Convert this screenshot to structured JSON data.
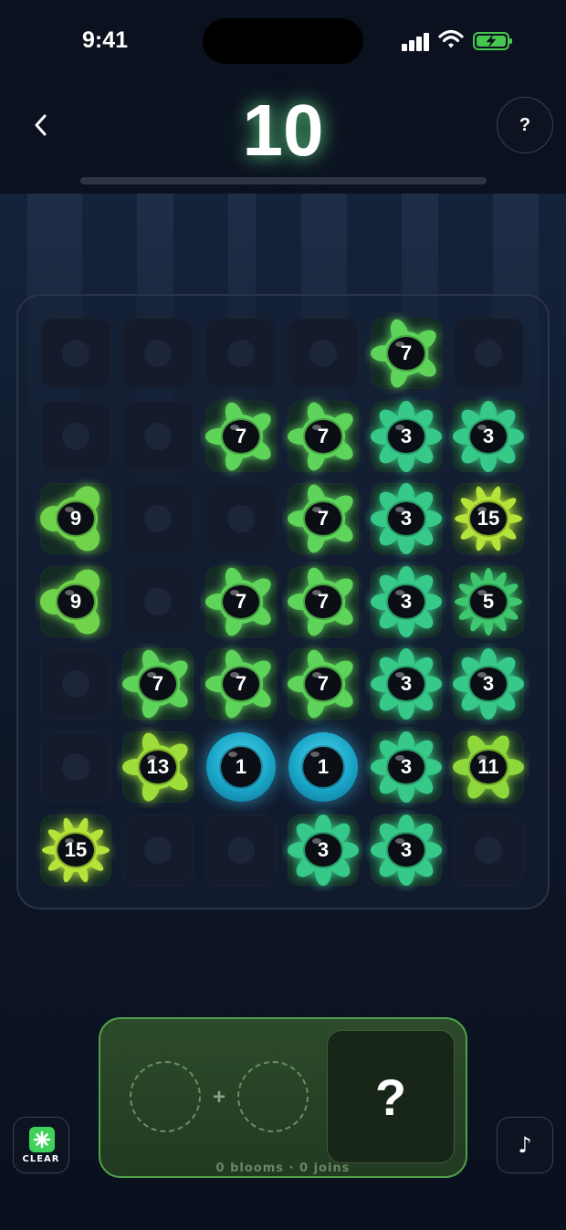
{
  "status_bar": {
    "time": "9:41"
  },
  "header": {
    "target": "10",
    "help_label": "?"
  },
  "board": {
    "rows": 7,
    "cols": 6,
    "cells": [
      [
        null,
        null,
        null,
        null,
        7,
        null
      ],
      [
        null,
        null,
        7,
        7,
        3,
        3
      ],
      [
        9,
        null,
        null,
        7,
        3,
        15
      ],
      [
        9,
        null,
        7,
        7,
        3,
        5
      ],
      [
        null,
        7,
        7,
        7,
        3,
        3
      ],
      [
        null,
        13,
        1,
        1,
        3,
        11
      ],
      [
        15,
        null,
        null,
        3,
        3,
        null
      ]
    ]
  },
  "tray": {
    "plus": "+",
    "result": "?",
    "stats": "0 blooms · 0 joins"
  },
  "controls": {
    "clear_label": "CLEAR",
    "music_icon": "♪"
  },
  "colors": {
    "3": "#36c98a",
    "5": "#3ec76e",
    "7": "#5ed45a",
    "9": "#6fd44c",
    "11": "#8ed83c",
    "13": "#9ede3a",
    "15": "#b4e33a",
    "1": "#22b4d8"
  }
}
